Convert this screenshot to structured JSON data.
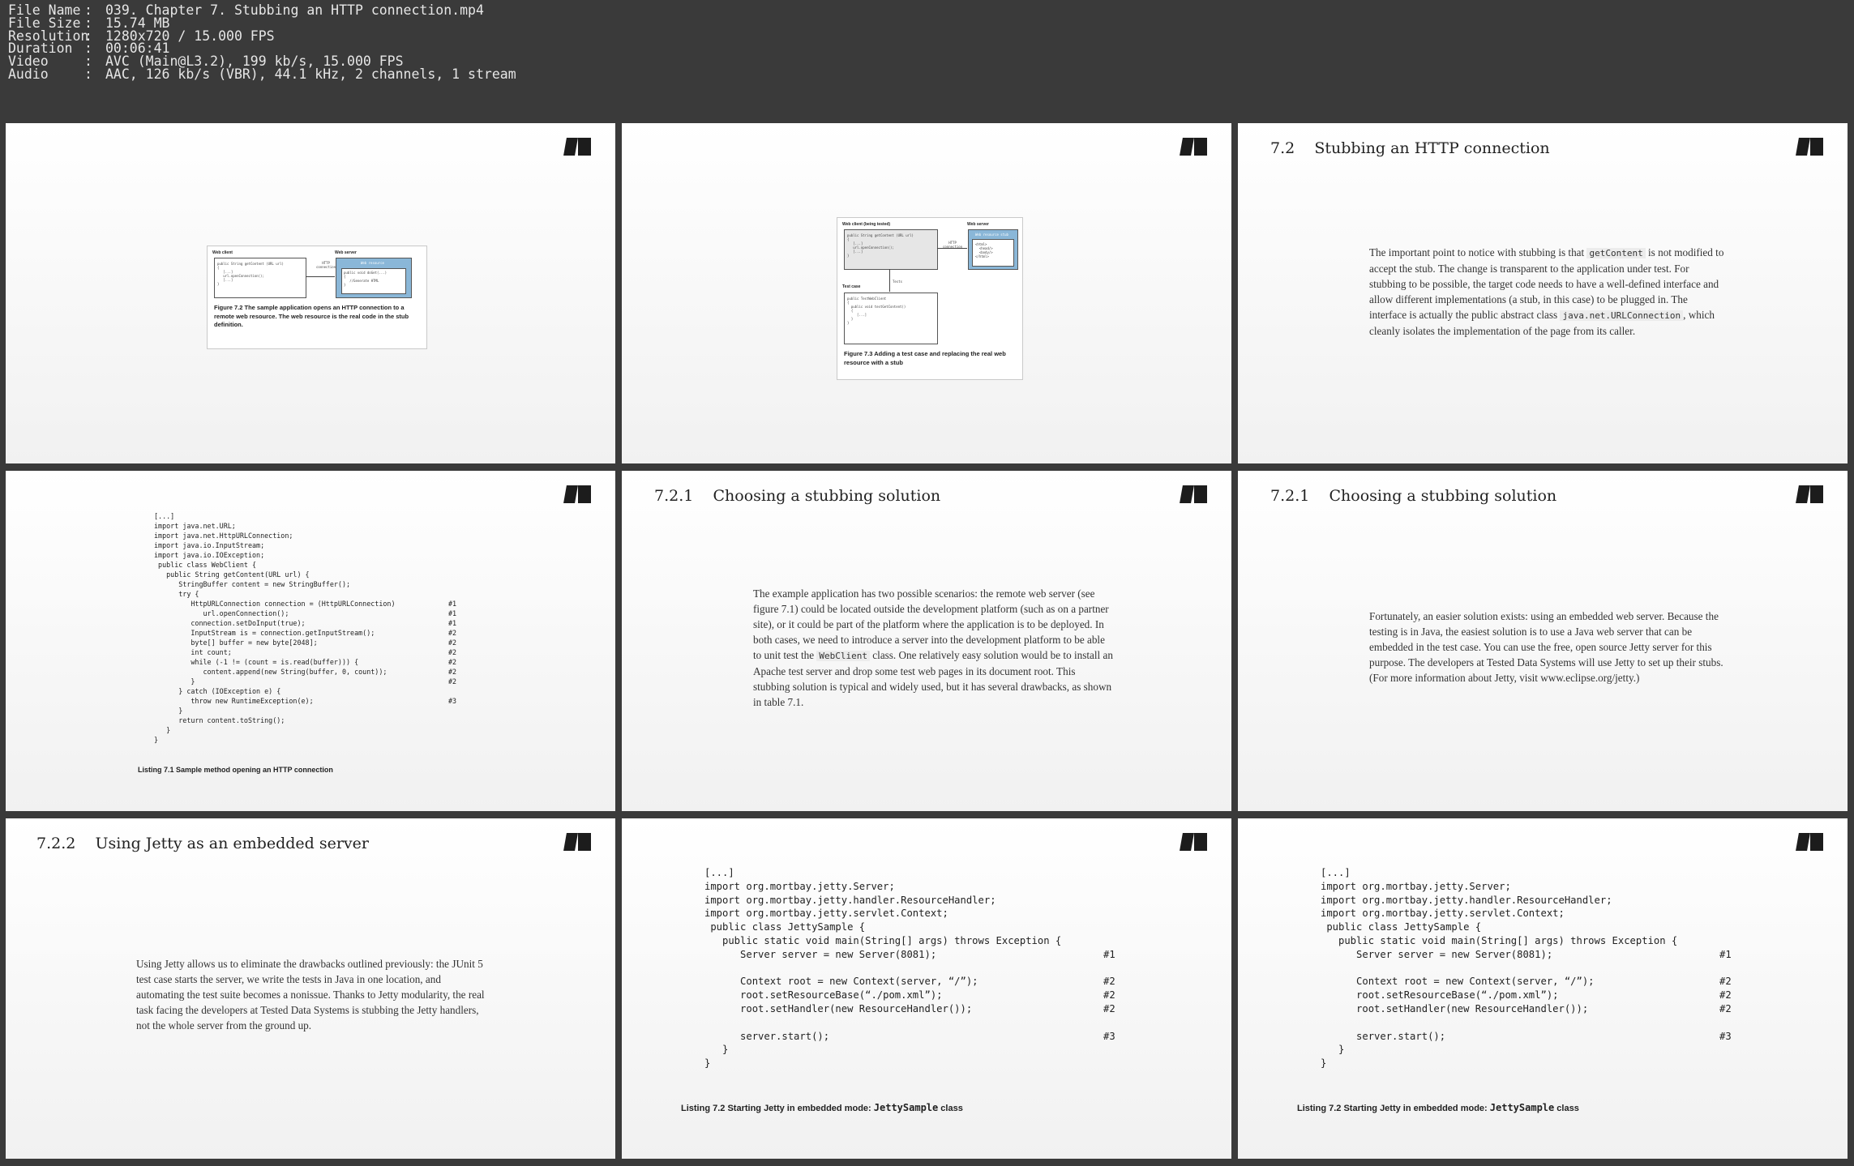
{
  "file_info": [
    {
      "key": "File Name",
      "value": "039. Chapter 7. Stubbing an HTTP connection.mp4"
    },
    {
      "key": "File Size",
      "value": "15.74 MB"
    },
    {
      "key": "Resolution",
      "value": "1280x720 / 15.000 FPS"
    },
    {
      "key": "Duration",
      "value": "00:06:41"
    },
    {
      "key": "Video",
      "value": "AVC (Main@L3.2), 199 kb/s, 15.000 FPS"
    },
    {
      "key": "Audio",
      "value": "AAC, 126 kb/s (VBR), 44.1 kHz, 2 channels, 1 stream"
    }
  ],
  "separator": ":",
  "thumbs": {
    "t1": {
      "fig": {
        "web_client": "Web client",
        "web_server": "Web server",
        "code_lines": [
          "public String getContent (URL url)",
          "{",
          "   [...]",
          "   url.openConnection();",
          "   [...]",
          "}"
        ],
        "http": "HTTP\nconnection",
        "resource": "Web resource",
        "resource_code": [
          "public void doGet(...)",
          "{",
          "   //Generate HTML",
          "}"
        ],
        "caption": "Figure 7.2 The sample application opens an HTTP connection to a remote web resource. The web resource is the real code in the stub definition."
      }
    },
    "t2": {
      "fig": {
        "web_client": "Web client (being tested)",
        "web_server": "Web server",
        "code_lines": [
          "public String getContent (URL url)",
          "{",
          "   [...]",
          "   url.openConnection();",
          "   [...]",
          "}"
        ],
        "http": "HTTP\nconnection",
        "stub": "Web resource stub",
        "stub_code": [
          "<html>",
          "  <head/>",
          "  <body/>",
          "</html>"
        ],
        "test_case": "Test case",
        "test_code": [
          "public TestWebClient",
          "{",
          "  public void testGetContent()",
          "  {",
          "     [...]",
          "  }",
          "}"
        ],
        "arrow_label": "Tests",
        "caption": "Figure 7.3 Adding a test case and replacing the real web resource with a stub"
      }
    },
    "t3": {
      "title": "7.2    Stubbing an HTTP connection",
      "p1": "The important point to notice with stubbing is that",
      "c1": "getContent",
      "p2": "is not modified to accept the stub. The change is transparent to the application under test. For stubbing to be possible, the target code needs to have a well-defined interface and allow different implementations (a stub, in this case) to be plugged in. The interface is actually the public abstract class",
      "c2": "java.net.URLConnection",
      "p3": ", which cleanly isolates the implementation of the page from its caller."
    },
    "t4": {
      "code": [
        {
          "t": "[...]",
          "m": ""
        },
        {
          "t": "import java.net.URL;",
          "m": ""
        },
        {
          "t": "import java.net.HttpURLConnection;",
          "m": ""
        },
        {
          "t": "import java.io.InputStream;",
          "m": ""
        },
        {
          "t": "import java.io.IOException;",
          "m": ""
        },
        {
          "t": " public class WebClient {",
          "m": ""
        },
        {
          "t": "   public String getContent(URL url) {",
          "m": ""
        },
        {
          "t": "      StringBuffer content = new StringBuffer();",
          "m": ""
        },
        {
          "t": "      try {",
          "m": ""
        },
        {
          "t": "         HttpURLConnection connection = (HttpURLConnection)",
          "m": "#1"
        },
        {
          "t": "            url.openConnection();",
          "m": "#1"
        },
        {
          "t": "         connection.setDoInput(true);",
          "m": "#1"
        },
        {
          "t": "         InputStream is = connection.getInputStream();",
          "m": "#2"
        },
        {
          "t": "         byte[] buffer = new byte[2048];",
          "m": "#2"
        },
        {
          "t": "         int count;",
          "m": "#2"
        },
        {
          "t": "         while (-1 != (count = is.read(buffer))) {",
          "m": "#2"
        },
        {
          "t": "            content.append(new String(buffer, 0, count));",
          "m": "#2"
        },
        {
          "t": "         }",
          "m": "#2"
        },
        {
          "t": "      } catch (IOException e) {",
          "m": ""
        },
        {
          "t": "         throw new RuntimeException(e);",
          "m": "#3"
        },
        {
          "t": "      }",
          "m": ""
        },
        {
          "t": "      return content.toString();",
          "m": ""
        },
        {
          "t": "   }",
          "m": ""
        },
        {
          "t": "}",
          "m": ""
        }
      ],
      "caption": "Listing 7.1 Sample method opening an HTTP connection"
    },
    "t5": {
      "title": "7.2.1    Choosing a stubbing solution",
      "p1": "The example application has two possible scenarios: the remote web server (see figure 7.1) could be located outside the development platform (such as on a partner site), or it could be part of the platform where the application is to be deployed. In both cases, we need to introduce a server into the development platform to be able to unit test the",
      "c1": "WebClient",
      "p2": "class. One relatively easy solution would be to install an Apache test server and drop some test web pages in its document root. This stubbing solution is typical and widely used, but it has several drawbacks, as shown in table 7.1."
    },
    "t6": {
      "title": "7.2.1    Choosing a stubbing solution",
      "p1": "Fortunately, an easier solution exists: using an embedded web server. Because the testing is in Java, the easiest solution is to use a Java web server that can be embedded in the test case. You can use the free, open source Jetty server for this purpose. The developers at Tested Data Systems will use Jetty to set up their stubs. (For more information about Jetty, visit www.eclipse.org/jetty.)"
    },
    "t7": {
      "title": "7.2.2    Using Jetty as an embedded server",
      "p1": "Using Jetty allows us to eliminate the drawbacks outlined previously: the JUnit 5 test case starts the server, we write the tests in Java in one location, and automating the test suite becomes a nonissue. Thanks to Jetty modularity, the real task facing the developers at Tested Data Systems is stubbing the Jetty handlers, not the whole server from the ground up."
    },
    "jetty": {
      "code": [
        {
          "t": "[...]",
          "m": ""
        },
        {
          "t": "import org.mortbay.jetty.Server;",
          "m": ""
        },
        {
          "t": "import org.mortbay.jetty.handler.ResourceHandler;",
          "m": ""
        },
        {
          "t": "import org.mortbay.jetty.servlet.Context;",
          "m": ""
        },
        {
          "t": " public class JettySample {",
          "m": ""
        },
        {
          "t": "   public static void main(String[] args) throws Exception {",
          "m": ""
        },
        {
          "t": "      Server server = new Server(8081);",
          "m": "#1"
        },
        {
          "t": "",
          "m": ""
        },
        {
          "t": "      Context root = new Context(server, “/”);",
          "m": "#2"
        },
        {
          "t": "      root.setResourceBase(“./pom.xml”);",
          "m": "#2"
        },
        {
          "t": "      root.setHandler(new ResourceHandler());",
          "m": "#2"
        },
        {
          "t": "",
          "m": ""
        },
        {
          "t": "      server.start();",
          "m": "#3"
        },
        {
          "t": "   }",
          "m": ""
        },
        {
          "t": "}",
          "m": ""
        }
      ],
      "caption_prefix": "Listing 7.2 Starting Jetty in embedded mode: ",
      "caption_code": "JettySample",
      "caption_suffix": " class"
    }
  }
}
